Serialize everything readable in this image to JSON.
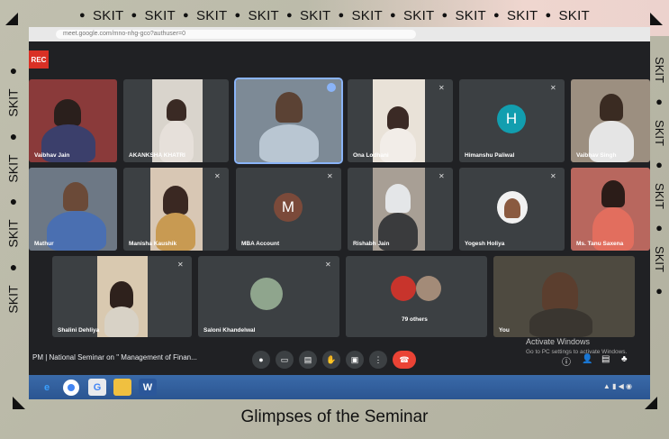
{
  "banner": {
    "repeat_text": "SKIT",
    "caption": "Glimpses of the Seminar"
  },
  "meet": {
    "rec_label": "REC",
    "url_text": "meet.google.com/mno-nhg-gco?authuser=0",
    "participants": [
      {
        "name": "Vaibhav Jain",
        "row": 1
      },
      {
        "name": "AKANKSHA KHATRI",
        "row": 1
      },
      {
        "name": "",
        "row": 1,
        "active": true
      },
      {
        "name": "Ona Lodhani",
        "row": 1
      },
      {
        "name": "Himanshu Paliwal",
        "row": 1,
        "avatar_letter": "H",
        "avatar_color": "#129eaf"
      },
      {
        "name": "Vaibhav Singh",
        "row": 1
      },
      {
        "name": "Mathur",
        "row": 2
      },
      {
        "name": "Manisha Kaushik",
        "row": 2
      },
      {
        "name": "MBA Account",
        "row": 2,
        "avatar_letter": "M",
        "avatar_color": "#7b4a3a"
      },
      {
        "name": "Rishabh Jain",
        "row": 2
      },
      {
        "name": "Yogesh Holiya",
        "row": 2
      },
      {
        "name": "Ms. Tanu Saxena",
        "row": 2
      },
      {
        "name": "Shalini Dehliya",
        "row": 3
      },
      {
        "name": "Saloni Khandelwal",
        "row": 3
      },
      {
        "name": "79 others",
        "row": 3
      },
      {
        "name": "You",
        "row": 3
      }
    ],
    "meeting_info": "PM | National Seminar on \" Management of Finan...",
    "controls": [
      "mic-icon",
      "camera-icon",
      "captions-icon",
      "raise-hand-icon",
      "present-icon",
      "more-icon",
      "end-call-icon"
    ],
    "watermark_line1": "Activate Windows",
    "watermark_line2": "Go to PC settings to activate Windows."
  },
  "colors": {
    "meet_bg": "#202124",
    "tile_bg": "#3c4043",
    "end_call": "#ea4335",
    "frame": "#b7b6a4"
  }
}
